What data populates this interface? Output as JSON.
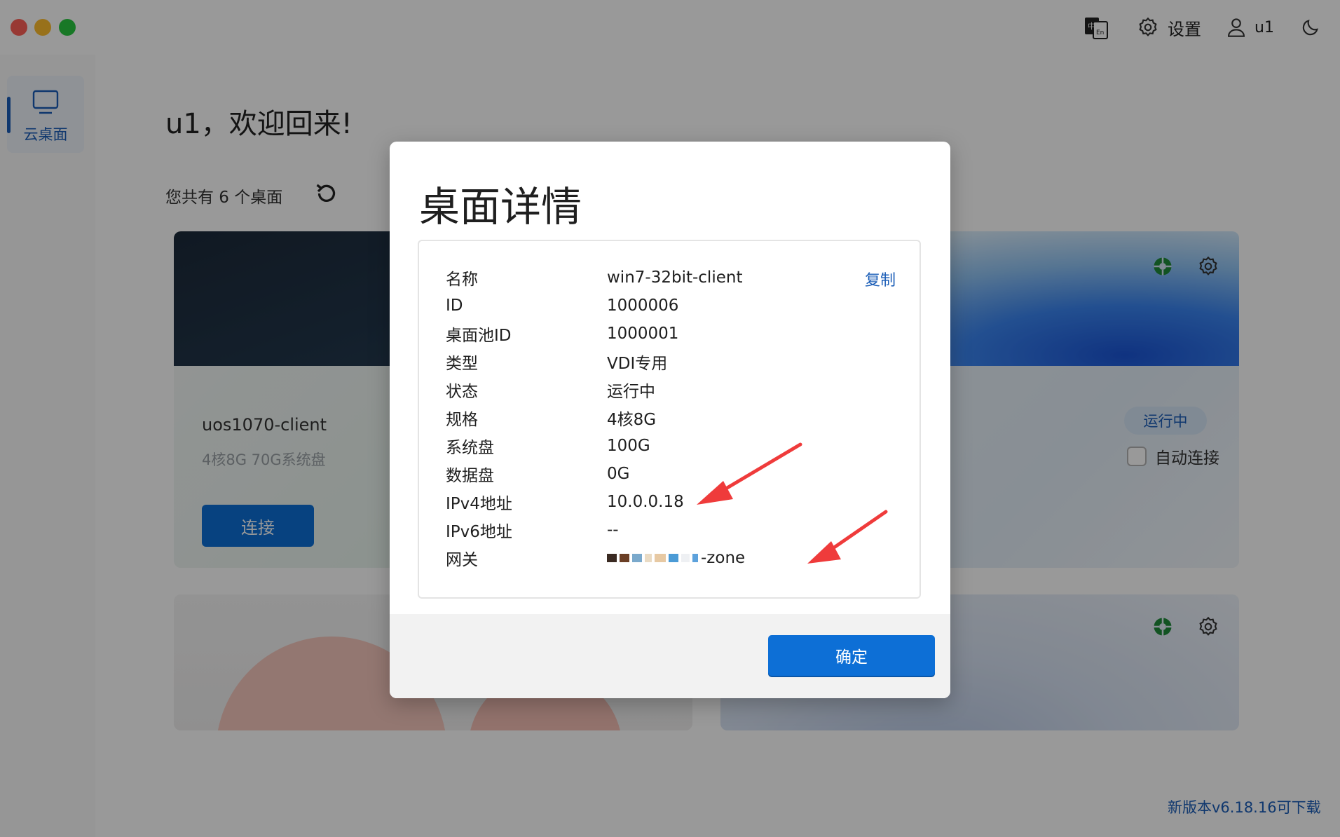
{
  "titlebar": {
    "settings_label": "设置",
    "user_name": "u1",
    "lang_icon": "language-toggle-icon"
  },
  "sidebar": {
    "items": [
      {
        "label": "云桌面",
        "icon": "monitor-icon",
        "active": true
      }
    ]
  },
  "main": {
    "welcome": "u1，欢迎回来!",
    "count_text": "您共有 6 个桌面",
    "update_link": "新版本v6.18.16可下载"
  },
  "cards": [
    {
      "name": "uos1070-client",
      "spec": "4核8G 70G系统盘",
      "button": "连接"
    },
    {
      "status": "运行中",
      "auto_connect_label": "自动连接"
    }
  ],
  "modal": {
    "title": "桌面详情",
    "copy_label": "复制",
    "rows": [
      {
        "label": "名称",
        "value": "win7-32bit-client"
      },
      {
        "label": "ID",
        "value": "1000006"
      },
      {
        "label": "桌面池ID",
        "value": "1000001"
      },
      {
        "label": "类型",
        "value": "VDI专用"
      },
      {
        "label": "状态",
        "value": "运行中"
      },
      {
        "label": "规格",
        "value": "4核8G"
      },
      {
        "label": "系统盘",
        "value": "100G"
      },
      {
        "label": "数据盘",
        "value": "0G"
      },
      {
        "label": "IPv4地址",
        "value": "10.0.0.18"
      },
      {
        "label": "IPv6地址",
        "value": "--"
      },
      {
        "label": "网关",
        "value": "-zone"
      }
    ],
    "ok_label": "确定"
  },
  "colors": {
    "accent": "#0d6fd6",
    "link": "#1a5db7",
    "arrow": "#ef3b3b"
  }
}
